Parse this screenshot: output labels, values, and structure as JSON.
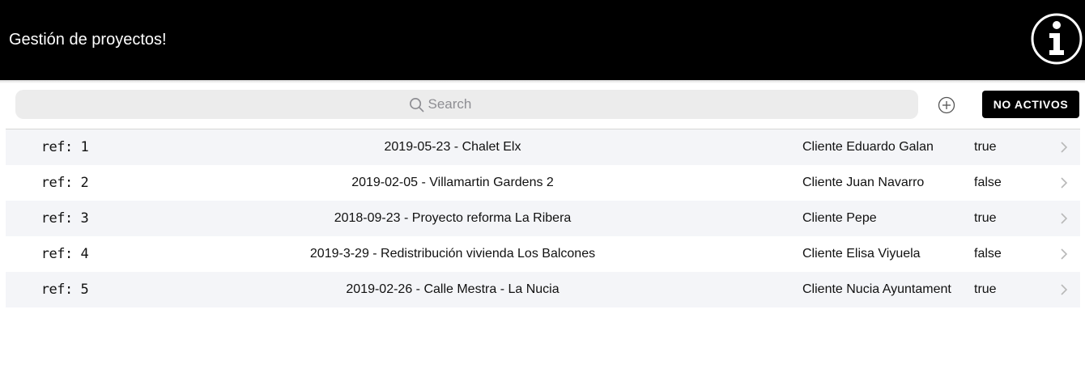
{
  "header": {
    "title": "Gestión de proyectos!",
    "info_icon": "info-circle-icon"
  },
  "toolbar": {
    "search_placeholder": "Search",
    "search_value": "",
    "add_icon": "add-circle-icon",
    "toggle_label": "NO ACTIVOS"
  },
  "colors": {
    "header_bg": "#000000",
    "row_alt": "#f4f5f8",
    "search_bg": "#ececec",
    "button_bg": "#000000"
  },
  "projects": [
    {
      "ref": "ref: 1",
      "title": "2019-05-23 - Chalet Elx",
      "client": "Cliente Eduardo Galan",
      "active": "true"
    },
    {
      "ref": "ref: 2",
      "title": "2019-02-05 - Villamartin Gardens 2",
      "client": "Cliente Juan Navarro",
      "active": "false"
    },
    {
      "ref": "ref: 3",
      "title": "2018-09-23 - Proyecto reforma La Ribera",
      "client": "Cliente Pepe",
      "active": "true"
    },
    {
      "ref": "ref: 4",
      "title": "2019-3-29 - Redistribución vivienda Los Balcones",
      "client": "Cliente Elisa Viyuela",
      "active": "false"
    },
    {
      "ref": "ref: 5",
      "title": "2019-02-26 - Calle Mestra - La Nucia",
      "client": "Cliente Nucia Ayuntament",
      "active": "true"
    }
  ]
}
